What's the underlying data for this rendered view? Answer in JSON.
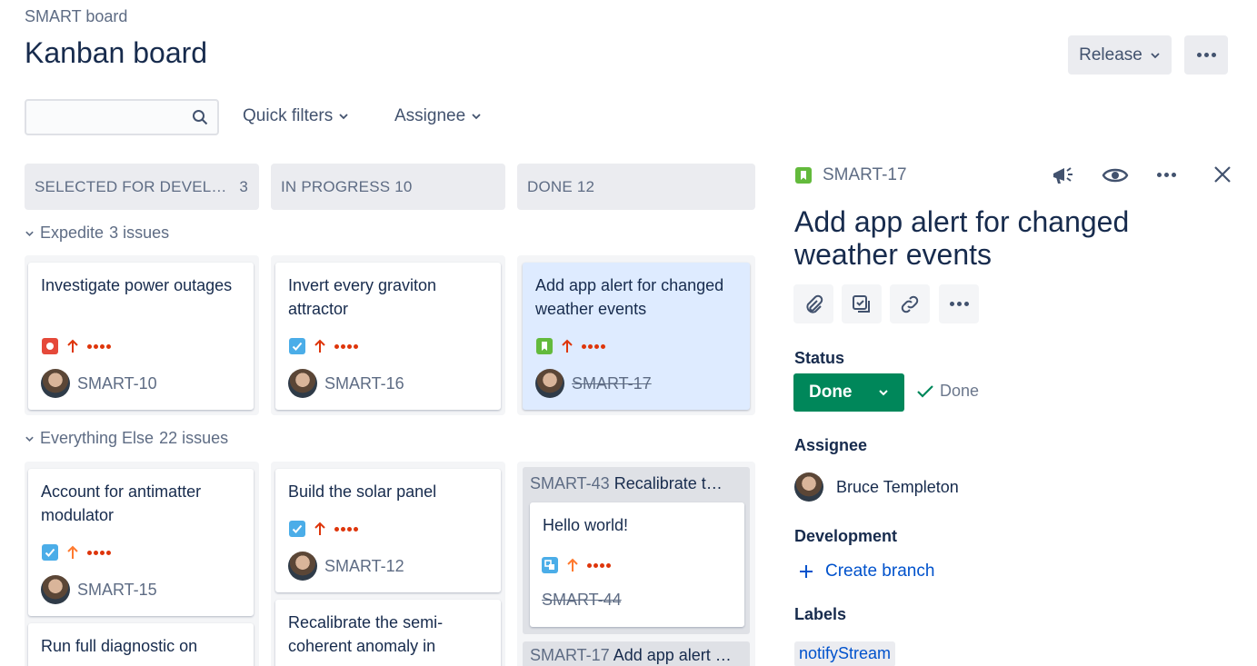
{
  "breadcrumb": "SMART board",
  "title": "Kanban board",
  "header": {
    "release_label": "Release"
  },
  "search": {
    "placeholder": ""
  },
  "filters": {
    "quick_filters": "Quick filters",
    "assignee": "Assignee"
  },
  "columns": [
    {
      "name": "SELECTED FOR DEVEL…",
      "count": "3"
    },
    {
      "name": "IN PROGRESS 10",
      "count": ""
    },
    {
      "name": "DONE 12",
      "count": ""
    }
  ],
  "swimlanes": [
    {
      "name": "Expedite",
      "count": "3 issues"
    },
    {
      "name": "Everything Else",
      "count": "22 issues"
    }
  ],
  "cards": {
    "c1": {
      "title": "Investigate power outages",
      "key": "SMART-10",
      "type": "bug"
    },
    "c2": {
      "title": "Invert every graviton attractor",
      "key": "SMART-16",
      "type": "task"
    },
    "c3": {
      "title": "Add app alert for changed weather events",
      "key": "SMART-17",
      "type": "story"
    },
    "c4": {
      "title": "Account for antimatter modulator",
      "key": "SMART-15",
      "type": "task"
    },
    "c5": {
      "title": "Build the solar panel",
      "key": "SMART-12",
      "type": "task"
    },
    "c6": {
      "title": "Recalibrate the semi-coherent anomaly in",
      "key": "",
      "type": "task"
    },
    "c7": {
      "title": "Run full diagnostic on",
      "key": "",
      "type": "task"
    },
    "c8": {
      "title": "Hello world!",
      "key": "SMART-44",
      "type": "subtask"
    }
  },
  "parents": {
    "p1": {
      "key": "SMART-43",
      "title": "Recalibrate t…"
    },
    "p2": {
      "key": "SMART-17",
      "title": "Add app alert …"
    }
  },
  "detail": {
    "key": "SMART-17",
    "title": "Add app alert for changed weather events",
    "status_label": "Status",
    "status_value": "Done",
    "resolution": "Done",
    "assignee_label": "Assignee",
    "assignee_name": "Bruce Templeton",
    "development_label": "Development",
    "create_branch": "Create branch",
    "labels_label": "Labels",
    "label_value": "notifyStream"
  },
  "colors": {
    "accent": "#0052CC",
    "done_green": "#00875A",
    "selected_card": "#DEEBFF",
    "priority_red": "#DE350B",
    "priority_orange": "#FF7A2F"
  }
}
